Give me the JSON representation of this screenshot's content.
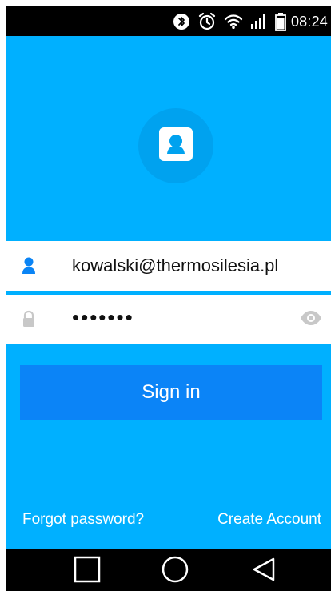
{
  "status_bar": {
    "time": "08:24",
    "icons": [
      "bluetooth-icon",
      "alarm-icon",
      "wifi-icon",
      "signal-icon",
      "battery-icon"
    ]
  },
  "colors": {
    "background": "#00b0ff",
    "avatar": "#00a2ef",
    "button": "#0b84f7",
    "status_bar": "#000000",
    "field_icon_active": "#0a84f5",
    "field_icon_inactive": "#c8c8c8"
  },
  "login": {
    "email_value": "kowalski@thermosilesia.pl",
    "password_mask": "•••••••",
    "sign_in_label": "Sign in",
    "forgot_password_label": "Forgot password?",
    "create_account_label": "Create Account"
  },
  "navigation": {
    "buttons": [
      "recent-apps-button",
      "home-button",
      "back-button"
    ]
  }
}
